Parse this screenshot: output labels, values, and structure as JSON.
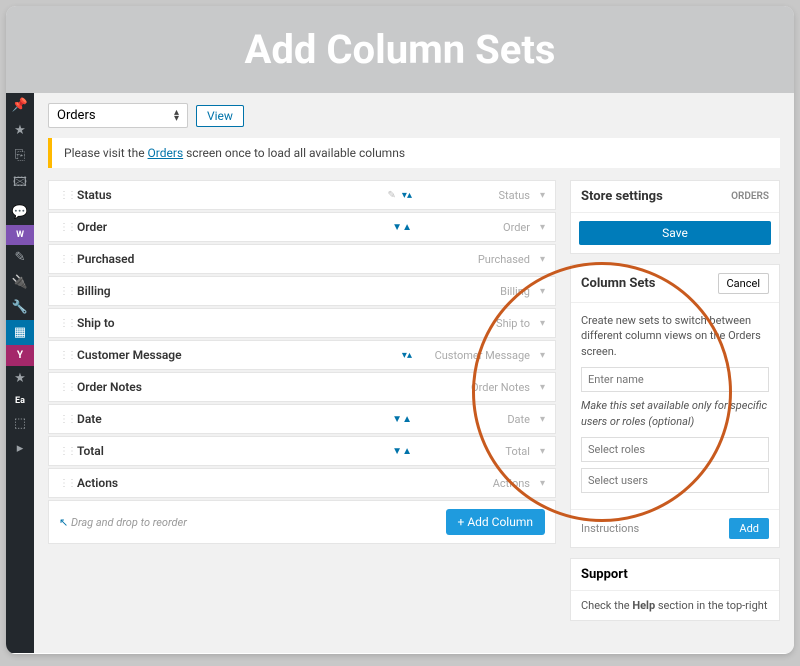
{
  "banner": {
    "title": "Add Column Sets"
  },
  "topbar": {
    "selected": "Orders",
    "view_label": "View"
  },
  "notice": {
    "prefix": "Please visit the ",
    "link": "Orders",
    "suffix": " screen once to load all available columns"
  },
  "columns": [
    {
      "label": "Status",
      "type": "Status",
      "icons": "edit"
    },
    {
      "label": "Order",
      "type": "Order",
      "icons": "sort"
    },
    {
      "label": "Purchased",
      "type": "Purchased",
      "icons": ""
    },
    {
      "label": "Billing",
      "type": "Billing",
      "icons": ""
    },
    {
      "label": "Ship to",
      "type": "Ship to",
      "icons": ""
    },
    {
      "label": "Customer Message",
      "type": "Customer Message",
      "icons": "filter"
    },
    {
      "label": "Order Notes",
      "type": "Order Notes",
      "icons": ""
    },
    {
      "label": "Date",
      "type": "Date",
      "icons": "sort"
    },
    {
      "label": "Total",
      "type": "Total",
      "icons": "sort"
    },
    {
      "label": "Actions",
      "type": "Actions",
      "icons": ""
    }
  ],
  "dnd_hint": "Drag and drop to reorder",
  "add_column_label": "+ Add Column",
  "store_box": {
    "title": "Store settings",
    "tag": "ORDERS",
    "save_label": "Save"
  },
  "colset_box": {
    "title": "Column Sets",
    "cancel_label": "Cancel",
    "description": "Create new sets to switch between different column views on the Orders screen.",
    "name_placeholder": "Enter name",
    "availability_note": "Make this set available only for specific users or roles (optional)",
    "roles_placeholder": "Select roles",
    "users_placeholder": "Select users",
    "instructions_label": "Instructions",
    "add_label": "Add"
  },
  "support_box": {
    "title": "Support",
    "text_prefix": "Check the ",
    "text_bold": "Help",
    "text_suffix": " section in the top-right"
  },
  "wp_icons": [
    "📌",
    "★",
    "📑",
    "🗂",
    "💬",
    "woo",
    "✎",
    "🔌",
    "🔧",
    "⬒",
    "Y",
    "★",
    "Ea",
    "⬚",
    "▸"
  ]
}
